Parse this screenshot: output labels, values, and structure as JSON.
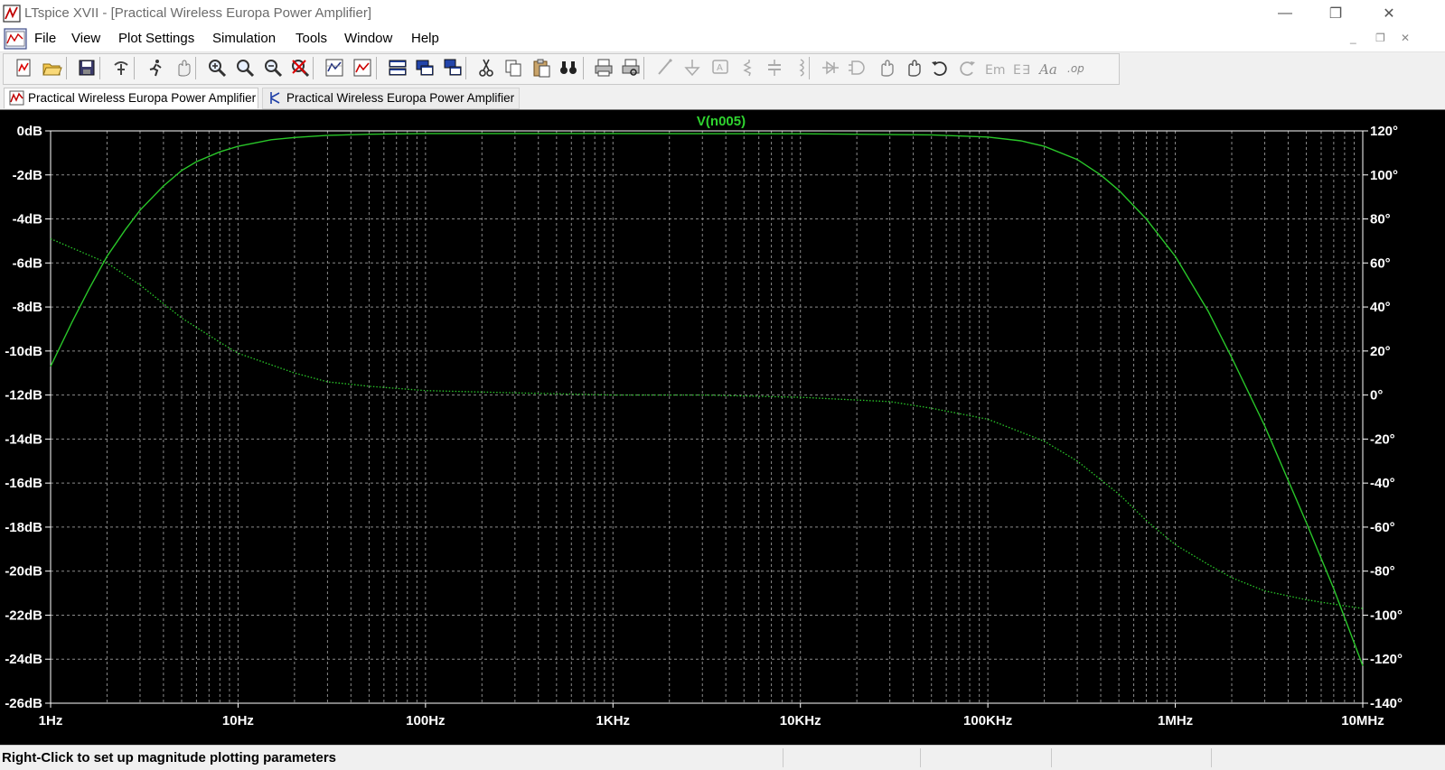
{
  "window": {
    "title": "LTspice XVII - [Practical Wireless Europa Power Amplifier]",
    "minimize_glyph": "—",
    "restore_glyph": "❐",
    "close_glyph": "✕"
  },
  "menu": {
    "items": [
      "File",
      "View",
      "Plot Settings",
      "Simulation",
      "Tools",
      "Window",
      "Help"
    ],
    "mdi_minimize": "_",
    "mdi_restore": "❐",
    "mdi_close": "✕"
  },
  "toolbar": {
    "buttons": [
      "new-schematic-icon",
      "open-icon",
      "save-icon",
      "control-panel-icon",
      "run-icon",
      "halt-icon",
      "zoom-in-icon",
      "zoom-area-icon",
      "zoom-out-icon",
      "zoom-cancel-icon",
      "autorange-icon",
      "fit-view-icon",
      "tile-horizontal-icon",
      "tile-vertical-icon",
      "cascade-icon",
      "cut-icon",
      "copy-icon",
      "paste-icon",
      "find-icon",
      "print-icon",
      "print-preview-icon",
      "wire-icon",
      "ground-icon",
      "label-net-icon",
      "resistor-icon",
      "capacitor-icon",
      "inductor-icon",
      "diode-icon",
      "component-icon",
      "move-icon",
      "drag-icon",
      "undo-icon",
      "redo-icon",
      "rotate-icon",
      "mirror-icon",
      "text-icon",
      "spice-directive-icon"
    ]
  },
  "tabs": [
    {
      "label": "Practical Wireless Europa Power Amplifier",
      "icon": "waveform-icon",
      "active": true
    },
    {
      "label": "Practical Wireless Europa Power Amplifier",
      "icon": "schematic-icon",
      "active": false
    }
  ],
  "status": {
    "text": "Right-Click to set up magnitude plotting parameters"
  },
  "colors": {
    "plot_background": "#000000",
    "trace": "#29c629",
    "axis_text": "#ffffff",
    "grid": "#8a8a8a",
    "trace_label": "#2fd22f"
  },
  "chart_data": {
    "type": "line",
    "title": "V(n005)",
    "x_scale": "log",
    "x_ticks": [
      "1Hz",
      "10Hz",
      "100Hz",
      "1KHz",
      "10KHz",
      "100KHz",
      "1MHz",
      "10MHz"
    ],
    "xlim_hz": [
      1,
      10000000
    ],
    "y_left_ticks": [
      "0dB",
      "-2dB",
      "-4dB",
      "-6dB",
      "-8dB",
      "-10dB",
      "-12dB",
      "-14dB",
      "-16dB",
      "-18dB",
      "-20dB",
      "-22dB",
      "-24dB",
      "-26dB"
    ],
    "y_left_range_db": [
      -26,
      0
    ],
    "y_right_ticks": [
      "120°",
      "100°",
      "80°",
      "60°",
      "40°",
      "20°",
      "0°",
      "-20°",
      "-40°",
      "-60°",
      "-80°",
      "-100°",
      "-120°",
      "-140°"
    ],
    "y_right_range_deg": [
      -140,
      120
    ],
    "grid": true,
    "series": [
      {
        "name": "V(n005)",
        "quantity": "magnitude",
        "style": "solid",
        "freq_hz": [
          1,
          1.3,
          1.6,
          2,
          2.5,
          3,
          4,
          5,
          6,
          8,
          10,
          15,
          20,
          30,
          50,
          100,
          1000,
          10000,
          50000,
          100000,
          150000,
          200000,
          300000,
          400000,
          500000,
          700000,
          1000000,
          1500000,
          2000000,
          3000000,
          5000000,
          7000000,
          10000000
        ],
        "db": [
          -10.7,
          -8.7,
          -7.2,
          -5.7,
          -4.5,
          -3.6,
          -2.5,
          -1.8,
          -1.4,
          -0.95,
          -0.7,
          -0.4,
          -0.3,
          -0.2,
          -0.15,
          -0.12,
          -0.12,
          -0.13,
          -0.18,
          -0.28,
          -0.45,
          -0.7,
          -1.3,
          -2.0,
          -2.7,
          -4.0,
          -5.7,
          -8.2,
          -10.3,
          -13.4,
          -17.8,
          -20.8,
          -24.3
        ]
      },
      {
        "name": "V(n005)",
        "quantity": "phase",
        "style": "dotted",
        "freq_hz": [
          1,
          2,
          3,
          5,
          8,
          10,
          20,
          30,
          50,
          100,
          300,
          1000,
          3000,
          10000,
          30000,
          50000,
          100000,
          200000,
          300000,
          500000,
          700000,
          1000000,
          1500000,
          2000000,
          3000000,
          5000000,
          7000000,
          10000000
        ],
        "deg": [
          71,
          60,
          50,
          35,
          24,
          19,
          10,
          6,
          4,
          2,
          1,
          0,
          0,
          -1,
          -3,
          -6,
          -11,
          -21,
          -30,
          -45,
          -57,
          -68,
          -77,
          -83,
          -89,
          -93,
          -95,
          -97
        ]
      }
    ]
  }
}
